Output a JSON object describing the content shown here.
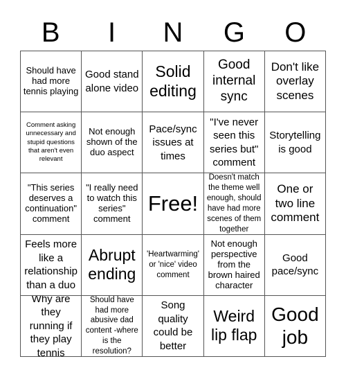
{
  "header": [
    "B",
    "I",
    "N",
    "G",
    "O"
  ],
  "cells": [
    [
      "Should have had more tennis playing",
      "Good stand alone video",
      "Solid editing",
      "Good internal sync",
      "Don't like overlay scenes"
    ],
    [
      "Comment asking unnecessary and stupid questions that aren't even relevant",
      "Not enough shown of the duo aspect",
      "Pace/sync issues at times",
      "\"I've never seen this series but\" comment",
      "Storytelling is good"
    ],
    [
      "\"This series deserves a continuation\" comment",
      "\"I really need to watch this series\" comment",
      "Free!",
      "Doesn't match the theme well enough, should have had more scenes of them together",
      "One or two line comment"
    ],
    [
      "Feels more like a relationship than a duo",
      "Abrupt ending",
      "'Heartwarming' or 'nice' video comment",
      "Not enough perspective from the brown haired character",
      "Good pace/sync"
    ],
    [
      "Why are they running if they play tennis",
      "Should have had more abusive dad content -where is the resolution?",
      "Song quality could be better",
      "Weird lip flap",
      "Good job"
    ]
  ]
}
